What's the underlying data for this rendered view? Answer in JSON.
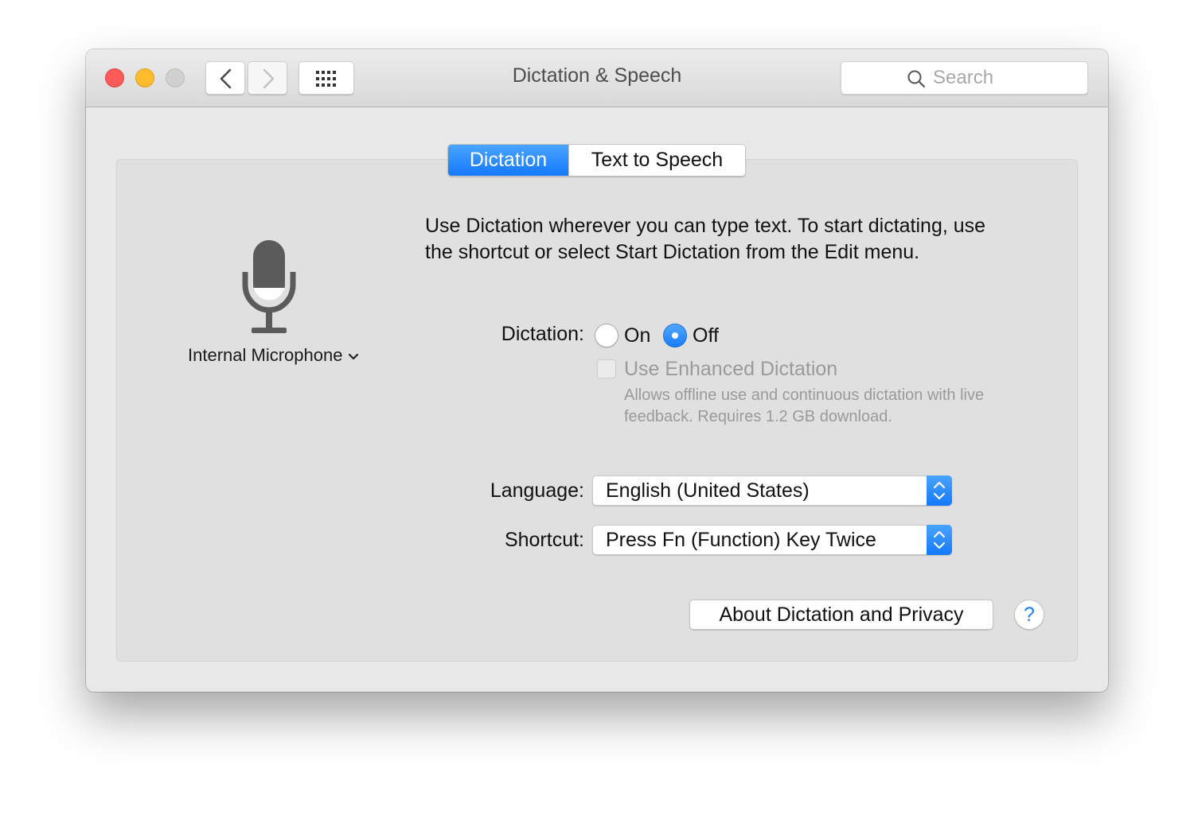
{
  "window": {
    "title": "Dictation & Speech"
  },
  "toolbar": {
    "search_placeholder": "Search"
  },
  "tabs": [
    {
      "label": "Dictation",
      "selected": true
    },
    {
      "label": "Text to Speech",
      "selected": false
    }
  ],
  "microphone": {
    "label": "Internal Microphone"
  },
  "intro_text": "Use Dictation wherever you can type text. To start dictating, use the shortcut or select Start Dictation from the Edit menu.",
  "dictation": {
    "label": "Dictation:",
    "on_label": "On",
    "off_label": "Off",
    "selected": "Off"
  },
  "enhanced": {
    "label": "Use Enhanced Dictation",
    "description": "Allows offline use and continuous dictation with live feedback. Requires 1.2 GB download.",
    "checked": false,
    "enabled": false
  },
  "language": {
    "label": "Language:",
    "value": "English (United States)"
  },
  "shortcut": {
    "label": "Shortcut:",
    "value": "Press Fn (Function) Key Twice"
  },
  "buttons": {
    "about": "About Dictation and Privacy",
    "help": "?"
  },
  "colors": {
    "accent": "#1a7cfb",
    "close": "#fc5b57",
    "minimize": "#fdbc2e",
    "zoom_disabled": "#d0d0d0"
  }
}
